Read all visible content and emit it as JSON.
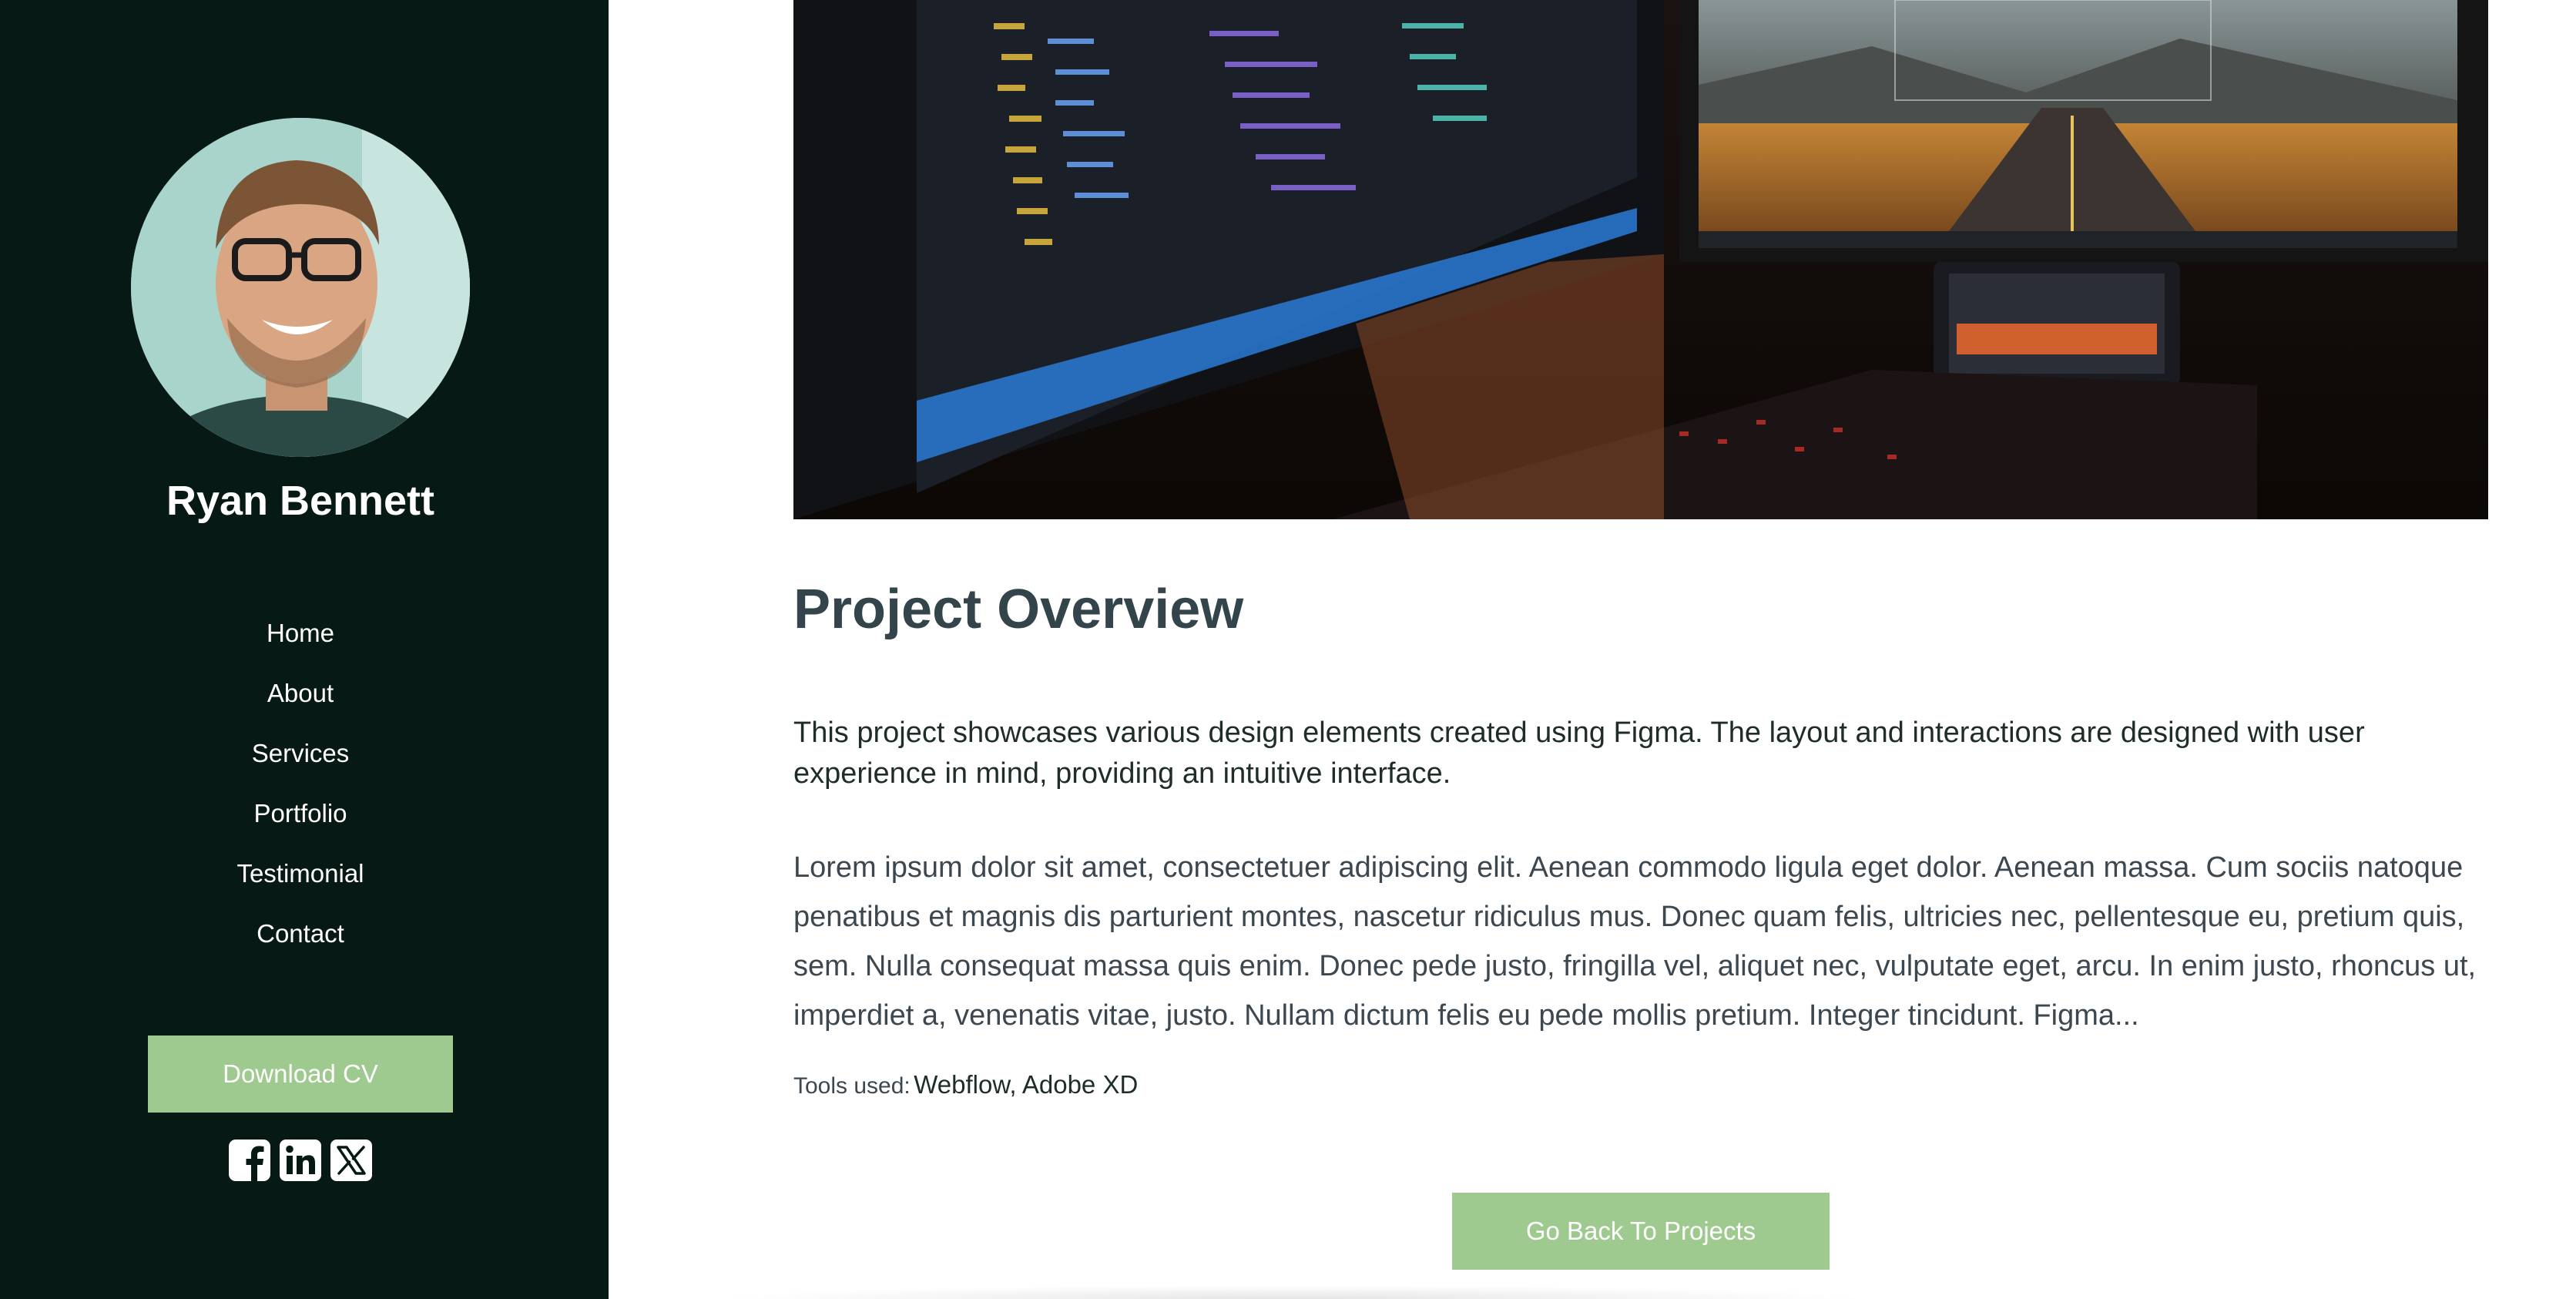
{
  "sidebar": {
    "name": "Ryan Bennett",
    "nav": [
      {
        "label": "Home"
      },
      {
        "label": "About"
      },
      {
        "label": "Services"
      },
      {
        "label": "Portfolio"
      },
      {
        "label": "Testimonial"
      },
      {
        "label": "Contact"
      }
    ],
    "download_label": "Download CV",
    "socials": [
      "facebook-icon",
      "linkedin-icon",
      "x-icon"
    ]
  },
  "project": {
    "title": "Project Overview",
    "intro": "This project showcases various design elements created using Figma. The layout and interactions are designed with user experience in mind, providing an intuitive interface.",
    "body": "Lorem ipsum dolor sit amet, consectetuer adipiscing elit. Aenean commodo ligula eget dolor. Aenean massa. Cum sociis natoque penatibus et magnis dis parturient montes, nascetur ridiculus mus. Donec quam felis, ultricies nec, pellentesque eu, pretium quis, sem. Nulla consequat massa quis enim. Donec pede justo, fringilla vel, aliquet nec, vulputate eget, arcu. In enim justo, rhoncus ut, imperdiet a, venenatis vitae, justo. Nullam dictum felis eu pede mollis pretium. Integer tincidunt. Figma...",
    "tools_label": "Tools used:",
    "tools_value": "Webflow, Adobe XD",
    "back_label": "Go Back To Projects"
  },
  "colors": {
    "sidebar_bg": "#071914",
    "button_bg": "#9fca8f",
    "heading": "#33444a",
    "text": "#3c4750"
  }
}
